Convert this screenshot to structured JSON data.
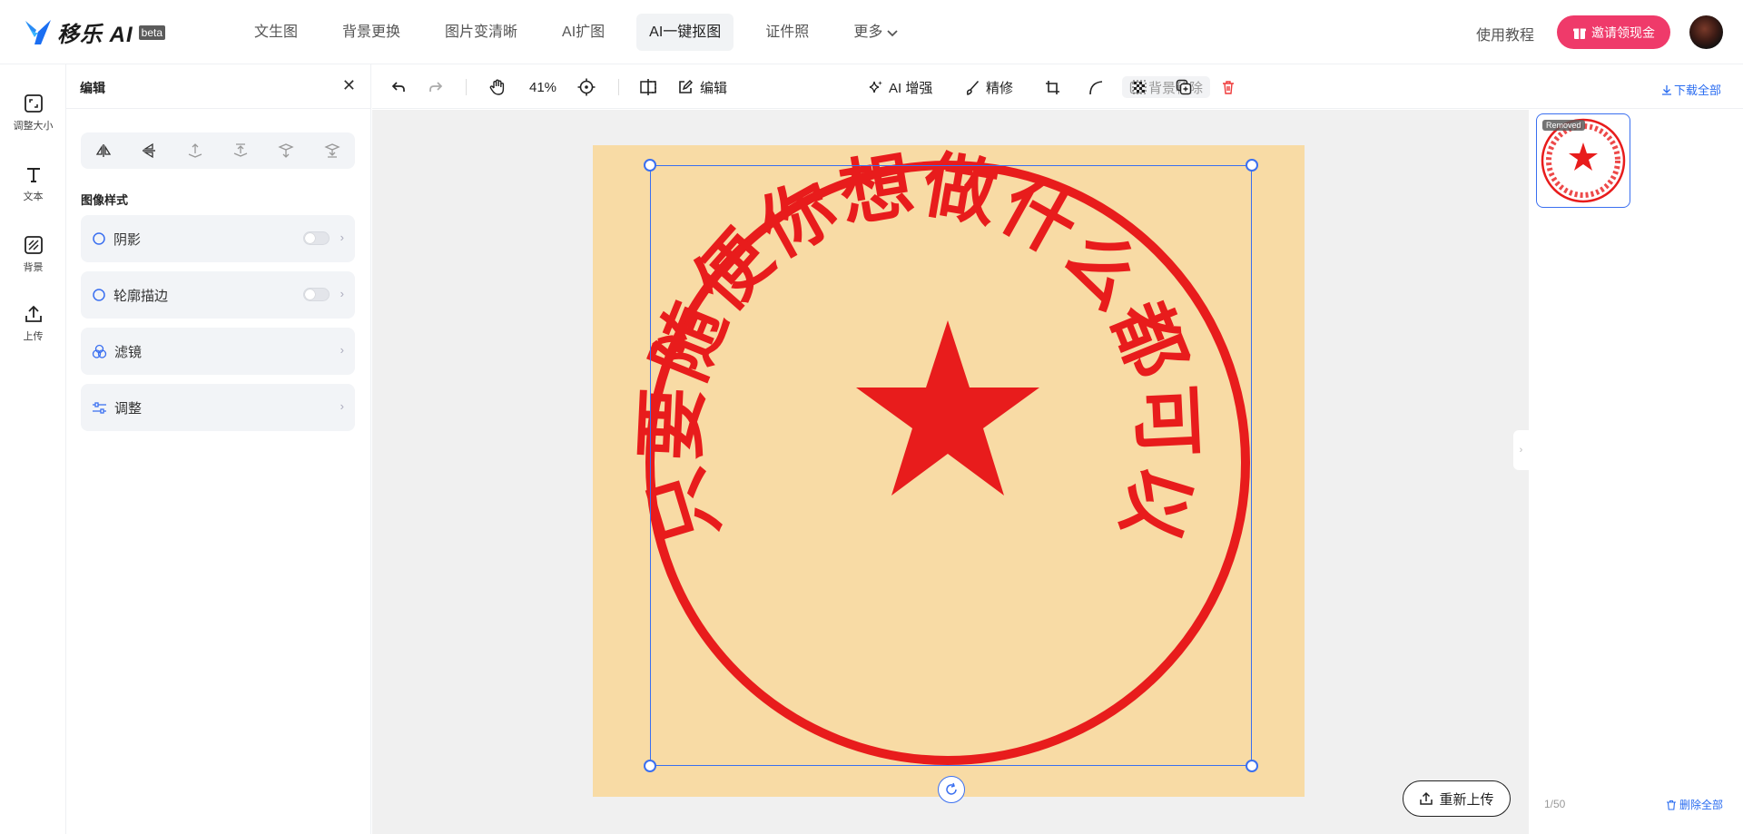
{
  "brand": {
    "name": "移乐 AI",
    "badge": "beta",
    "accent": "#2a6cf0",
    "invite_color": "#ef3a6a"
  },
  "nav": {
    "items": [
      {
        "label": "文生图",
        "active": false
      },
      {
        "label": "背景更换",
        "active": false
      },
      {
        "label": "图片变清晰",
        "active": false
      },
      {
        "label": "AI扩图",
        "active": false
      },
      {
        "label": "AI一键抠图",
        "active": true
      },
      {
        "label": "证件照",
        "active": false
      },
      {
        "label": "更多",
        "active": false
      }
    ]
  },
  "header": {
    "tutorial": "使用教程",
    "invite": "邀请领现金"
  },
  "toolstrip": {
    "items": [
      {
        "label": "调整大小",
        "icon": "resize-icon"
      },
      {
        "label": "文本",
        "icon": "text-icon"
      },
      {
        "label": "背景",
        "icon": "background-icon"
      },
      {
        "label": "上传",
        "icon": "upload-icon"
      }
    ]
  },
  "panel": {
    "title": "编辑",
    "section_title": "图像样式",
    "options": [
      {
        "label": "阴影",
        "icon": "circle-icon",
        "toggle": "off"
      },
      {
        "label": "轮廓描边",
        "icon": "circle-icon",
        "toggle": "off"
      },
      {
        "label": "滤镜",
        "icon": "filter-icon"
      },
      {
        "label": "调整",
        "icon": "sliders-icon"
      }
    ]
  },
  "toolbar": {
    "zoom": "41%",
    "edit": "编辑",
    "bg_remove": "背景移除",
    "ai_enhance": "AI 增强",
    "refine": "精修",
    "download_all": "下载全部"
  },
  "canvas": {
    "reupload": "重新上传",
    "stamp": {
      "text": "只要随便你想做什么都可以",
      "color": "#e81c1c",
      "background": "#f8dba5"
    }
  },
  "right": {
    "thumb_badge": "Removed",
    "pager": "1/50",
    "delete_all": "删除全部"
  }
}
